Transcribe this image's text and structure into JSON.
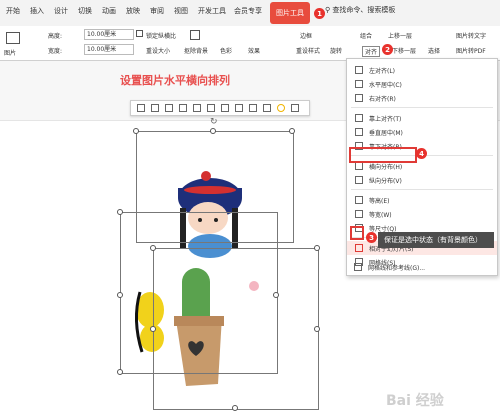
{
  "tabs": [
    "开始",
    "插入",
    "设计",
    "切换",
    "动画",
    "放映",
    "审阅",
    "视图",
    "开发工具",
    "会员专享"
  ],
  "active_tab": "图片工具",
  "search_label": "查找命令、搜索模板",
  "badges": {
    "b1": "1",
    "b2": "2",
    "b3": "3",
    "b4": "4"
  },
  "toolbar": {
    "height_label": "高度:",
    "height_value": "10.00厘米",
    "width_label": "宽度:",
    "width_value": "10.00厘米",
    "lock_ratio": "锁定纵横比",
    "reset_size": "重设大小",
    "remove_bg": "抠除背景",
    "color": "色彩",
    "effect": "效果",
    "border": "边框",
    "reset_style": "重设样式",
    "combine": "组合",
    "bring_forward": "上移一层",
    "send_backward": "下移一层",
    "align": "对齐",
    "rotate": "旋转",
    "select": "选择",
    "img_to_text": "图片转文字",
    "img_to_pdf": "图片转PDF",
    "img_print": "图片打印",
    "left_label": "图片"
  },
  "slide_title": "设置图片水平横向排列",
  "menu": {
    "items": [
      "左对齐(L)",
      "水平居中(C)",
      "右对齐(R)",
      "靠上对齐(T)",
      "垂直居中(M)",
      "靠下对齐(B)",
      "横向分布(H)",
      "纵向分布(V)",
      "等高(E)",
      "等宽(W)",
      "等尺寸(Q)",
      "相对于幻灯片(S)",
      "网格线(S)",
      "网格线和参考线(G)..."
    ]
  },
  "tooltip": "保证是选中状态（有背景颜色）",
  "watermark": "Bai 经验",
  "colors": {
    "accent": "#e84c3d",
    "highlight": "#e03a36",
    "title": "#e8504f"
  }
}
